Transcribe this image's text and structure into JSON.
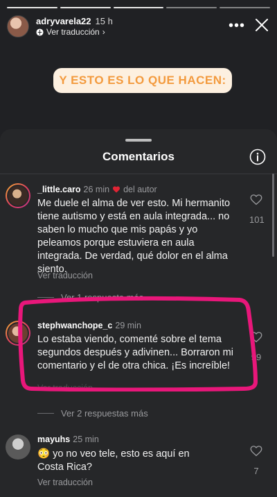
{
  "story": {
    "username": "adryvarela22",
    "time": "15 h",
    "translate_label": "Ver traducción",
    "caption": "Y ESTO ES LO QUE HACEN:"
  },
  "sheet": {
    "title": "Comentarios"
  },
  "comments": [
    {
      "user": "_little.caro",
      "time": "26 min",
      "author_tag": "del autor",
      "text": "Me duele el alma de ver esto. Mi hermanito tiene autismo y está en aula integrada... no saben lo mucho que mis papás y yo peleamos porque estuviera en aula integrada. De verdad, qué dolor en el alma siento.",
      "translate": "Ver traducción",
      "likes": "101",
      "replies": "Ver 1 respuesta más"
    },
    {
      "user": "stephwanchope_c",
      "time": "29 min",
      "text": "Lo estaba viendo, comenté sobre el tema segundos después y adivinen... Borraron mi comentario y el de otra chica. ¡Es increíble!",
      "translate": "Ver traducción",
      "likes": "99",
      "replies": "Ver 2 respuestas más"
    },
    {
      "user": "mayuhs",
      "time": "25 min",
      "emoji": "😳",
      "text": "yo no veo tele, esto es aquí en Costa Rica?",
      "translate": "Ver traducción",
      "likes": "7"
    }
  ],
  "colors": {
    "annotation": "#e8177a",
    "caption_bg": "#fdf0e0",
    "caption_text": "#f39a3d",
    "heart": "#e02434"
  }
}
